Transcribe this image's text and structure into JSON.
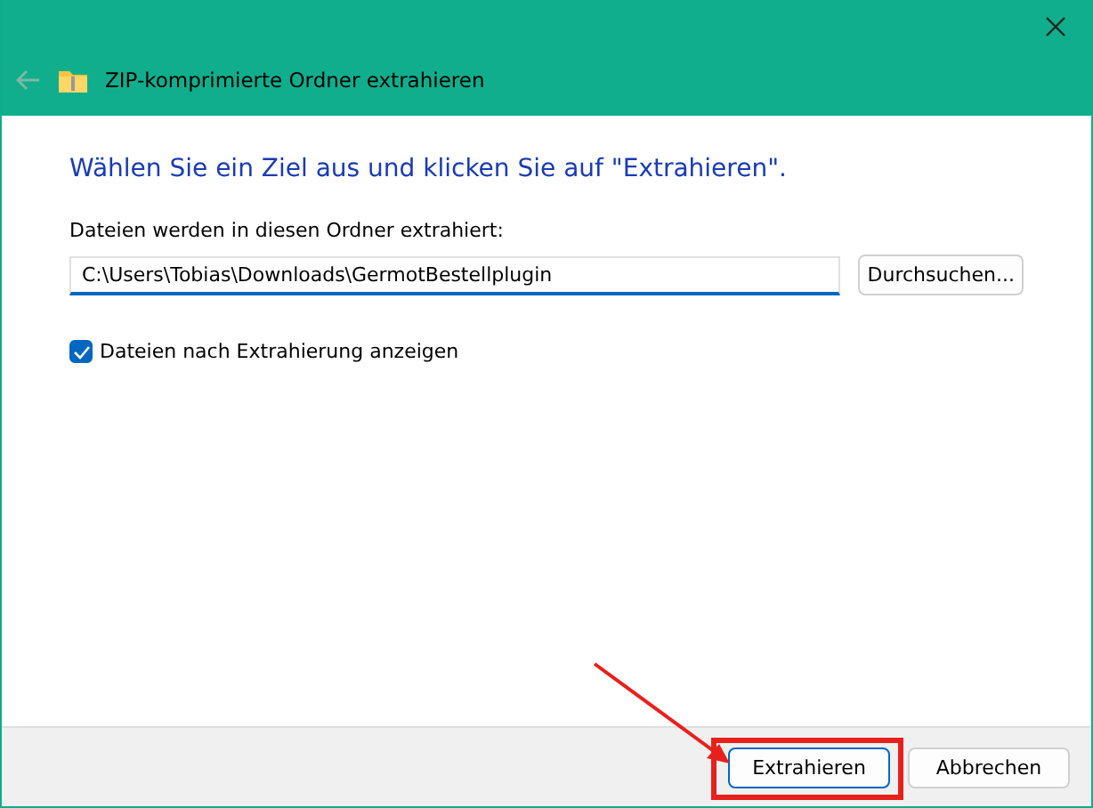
{
  "window": {
    "title": "ZIP-komprimierte Ordner extrahieren"
  },
  "heading": "Wählen Sie ein Ziel aus und klicken Sie auf \"Extrahieren\".",
  "destination": {
    "label": "Dateien werden in diesen Ordner extrahiert:",
    "value": "C:\\Users\\Tobias\\Downloads\\GermotBestellplugin",
    "browse_button": "Durchsuchen..."
  },
  "show_files": {
    "label": "Dateien nach Extrahierung anzeigen",
    "checked": true
  },
  "buttons": [
    {
      "label": "Extrahieren",
      "default": true
    },
    {
      "label": "Abbrechen",
      "default": false
    }
  ]
}
